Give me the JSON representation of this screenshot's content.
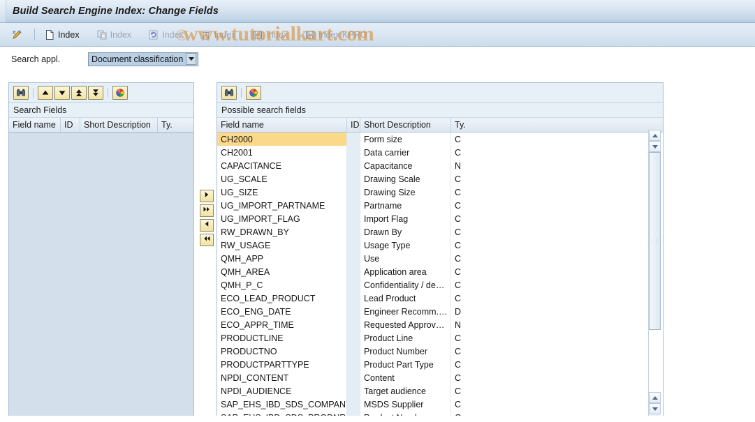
{
  "window": {
    "title": "Build Search Engine Index: Change Fields"
  },
  "toolbar": {
    "items": [
      {
        "icon": "pencil-icon",
        "label": "",
        "disabled": false
      },
      {
        "icon": "document-icon",
        "label": "Index",
        "disabled": false
      },
      {
        "icon": "copy-index-icon",
        "label": "Index",
        "disabled": true
      },
      {
        "icon": "refresh-index-icon",
        "label": "Index",
        "disabled": true
      },
      {
        "icon": "delete-index-icon",
        "label": "Index",
        "disabled": true
      },
      {
        "icon": "save-index-icon",
        "label": "Index",
        "disabled": true
      },
      {
        "icon": "save-index-kpro-icon",
        "label": "Index KPRO",
        "disabled": true
      }
    ]
  },
  "search_appl": {
    "label": "Search appl.",
    "value": "Document classification",
    "options": [
      "Document classification"
    ]
  },
  "left_panel": {
    "caption": "Search Fields",
    "toolbar": [
      {
        "icon": "binoculars-icon"
      },
      {
        "icon": "arrow-up-icon"
      },
      {
        "icon": "arrow-down-icon"
      },
      {
        "icon": "arrow-double-up-icon"
      },
      {
        "icon": "arrow-double-down-icon"
      },
      {
        "icon": "color-wheel-icon"
      }
    ],
    "columns": [
      "Field name",
      "ID",
      "Short Description",
      "Ty."
    ],
    "rows": []
  },
  "transfer_buttons": [
    {
      "icon": "arrow-right-icon",
      "name": "move-right-button"
    },
    {
      "icon": "arrow-double-right-icon",
      "name": "move-all-right-button"
    },
    {
      "icon": "arrow-left-icon",
      "name": "move-left-button"
    },
    {
      "icon": "arrow-double-left-icon",
      "name": "move-all-left-button"
    }
  ],
  "right_panel": {
    "caption": "Possible search fields",
    "toolbar": [
      {
        "icon": "binoculars-icon"
      },
      {
        "icon": "color-wheel-icon"
      }
    ],
    "columns": [
      "Field name",
      "ID",
      "Short Description",
      "Ty."
    ],
    "rows": [
      {
        "field_name": "CH2000",
        "id": "",
        "short_description": "Form size",
        "type": "C",
        "selected": true
      },
      {
        "field_name": "CH2001",
        "id": "",
        "short_description": "Data carrier",
        "type": "C",
        "selected": false
      },
      {
        "field_name": "CAPACITANCE",
        "id": "",
        "short_description": "Capacitance",
        "type": "N",
        "selected": false
      },
      {
        "field_name": "UG_SCALE",
        "id": "",
        "short_description": "Drawing Scale",
        "type": "C",
        "selected": false
      },
      {
        "field_name": "UG_SIZE",
        "id": "",
        "short_description": "Drawing Size",
        "type": "C",
        "selected": false
      },
      {
        "field_name": "UG_IMPORT_PARTNAME",
        "id": "",
        "short_description": "Partname",
        "type": "C",
        "selected": false
      },
      {
        "field_name": "UG_IMPORT_FLAG",
        "id": "",
        "short_description": "Import Flag",
        "type": "C",
        "selected": false
      },
      {
        "field_name": "RW_DRAWN_BY",
        "id": "",
        "short_description": "Drawn By",
        "type": "C",
        "selected": false
      },
      {
        "field_name": "RW_USAGE",
        "id": "",
        "short_description": "Usage Type",
        "type": "C",
        "selected": false
      },
      {
        "field_name": "QMH_APP",
        "id": "",
        "short_description": "Use",
        "type": "C",
        "selected": false
      },
      {
        "field_name": "QMH_AREA",
        "id": "",
        "short_description": "Application area",
        "type": "C",
        "selected": false
      },
      {
        "field_name": "QMH_P_C",
        "id": "",
        "short_description": "Confidentiality / de…",
        "type": "C",
        "selected": false
      },
      {
        "field_name": "ECO_LEAD_PRODUCT",
        "id": "",
        "short_description": "Lead Product",
        "type": "C",
        "selected": false
      },
      {
        "field_name": "ECO_ENG_DATE",
        "id": "",
        "short_description": "Engineer Recomm.…",
        "type": "D",
        "selected": false
      },
      {
        "field_name": "ECO_APPR_TIME",
        "id": "",
        "short_description": "Requested Approv…",
        "type": "N",
        "selected": false
      },
      {
        "field_name": "PRODUCTLINE",
        "id": "",
        "short_description": "Product Line",
        "type": "C",
        "selected": false
      },
      {
        "field_name": "PRODUCTNO",
        "id": "",
        "short_description": "Product Number",
        "type": "C",
        "selected": false
      },
      {
        "field_name": "PRODUCTPARTTYPE",
        "id": "",
        "short_description": "Product Part Type",
        "type": "C",
        "selected": false
      },
      {
        "field_name": "NPDI_CONTENT",
        "id": "",
        "short_description": "Content",
        "type": "C",
        "selected": false
      },
      {
        "field_name": "NPDI_AUDIENCE",
        "id": "",
        "short_description": "Target audience",
        "type": "C",
        "selected": false
      },
      {
        "field_name": "SAP_EHS_IBD_SDS_COMPANY",
        "id": "",
        "short_description": "MSDS Supplier",
        "type": "C",
        "selected": false
      },
      {
        "field_name": "SAP_EHS_IBD_SDS_PRODNR",
        "id": "",
        "short_description": "Product Number",
        "type": "C",
        "selected": false
      }
    ]
  },
  "watermark": {
    "text": "www.tutorialkart.com",
    "copyright": "©"
  },
  "colors": {
    "title_bar": "#c3d6e8",
    "selection": "#fbd98a",
    "panel_bg": "#f3f7fb",
    "accent": "#9cb4cc",
    "watermark": "#d68e3c"
  }
}
